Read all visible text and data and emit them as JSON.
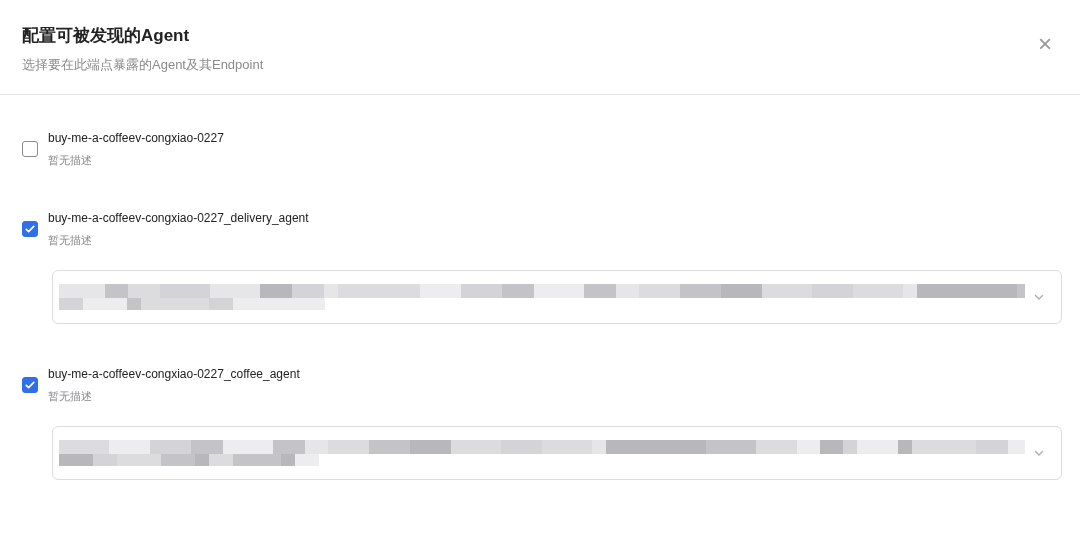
{
  "dialog": {
    "title": "配置可被发现的Agent",
    "subtitle": "选择要在此端点暴露的Agent及其Endpoint",
    "close": "×"
  },
  "agents": [
    {
      "name": "buy-me-a-coffeev-congxiao-0227",
      "description": "暂无描述",
      "checked": false
    },
    {
      "name": "buy-me-a-coffeev-congxiao-0227_delivery_agent",
      "description": "暂无描述",
      "checked": true
    },
    {
      "name": "buy-me-a-coffeev-congxiao-0227_coffee_agent",
      "description": "暂无描述",
      "checked": true
    }
  ]
}
